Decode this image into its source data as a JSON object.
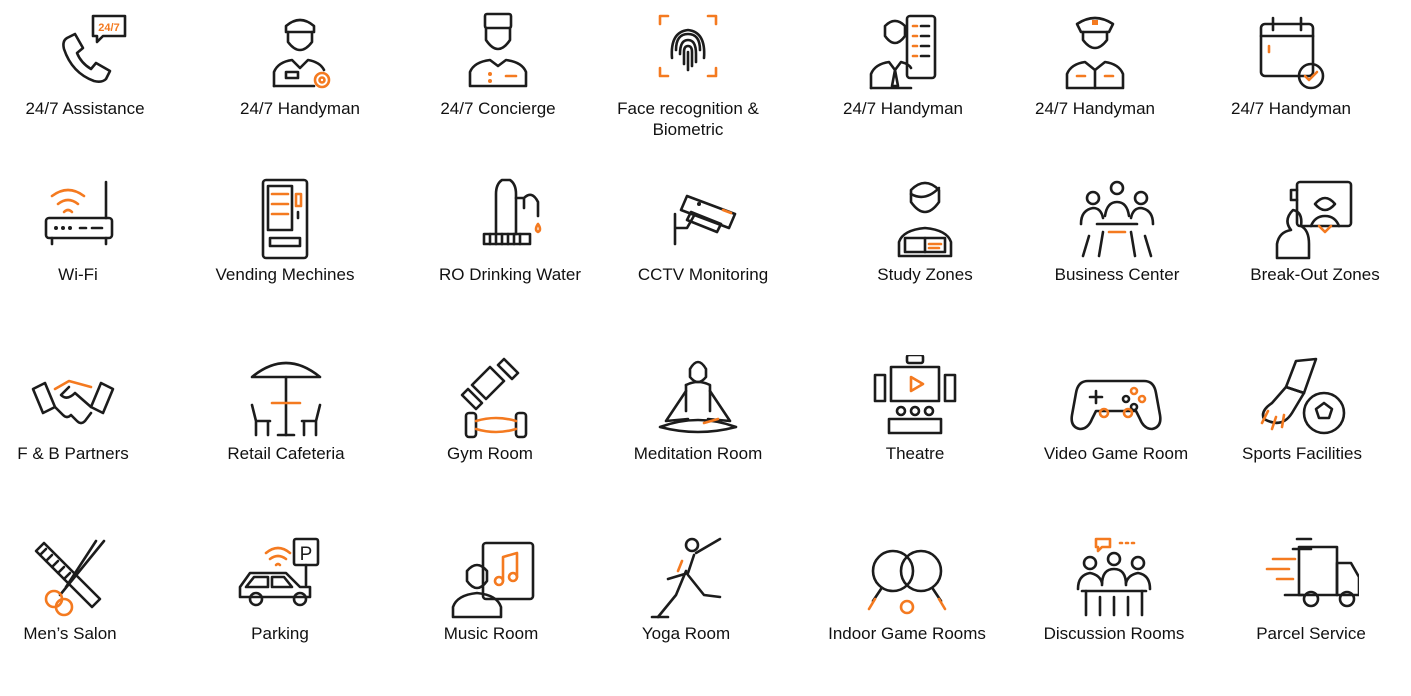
{
  "accent_color": "#f47a20",
  "line_color": "#1c1c1c",
  "amenities": [
    {
      "label": "24/7 Assistance",
      "icon": "phone-24-7-icon"
    },
    {
      "label": "24/7 Handyman",
      "icon": "handyman-gear-icon"
    },
    {
      "label": "24/7 Concierge",
      "icon": "concierge-icon"
    },
    {
      "label": "Face recognition & Biometric",
      "icon": "fingerprint-scan-icon"
    },
    {
      "label": "24/7 Handyman",
      "icon": "manager-checklist-icon"
    },
    {
      "label": "24/7 Handyman",
      "icon": "security-guard-icon"
    },
    {
      "label": "24/7 Handyman",
      "icon": "calendar-check-icon"
    },
    {
      "label": "Wi-Fi",
      "icon": "wifi-router-icon"
    },
    {
      "label": "Vending Mechines",
      "icon": "vending-machine-icon"
    },
    {
      "label": "RO Drinking Water",
      "icon": "water-purifier-icon"
    },
    {
      "label": "CCTV Monitoring",
      "icon": "cctv-camera-icon"
    },
    {
      "label": "Study Zones",
      "icon": "student-reading-icon"
    },
    {
      "label": "Business Center",
      "icon": "meeting-table-icon"
    },
    {
      "label": "Break-Out Zones",
      "icon": "video-call-icon"
    },
    {
      "label": "F & B Partners",
      "icon": "handshake-icon"
    },
    {
      "label": "Retail Cafeteria",
      "icon": "cafe-table-umbrella-icon"
    },
    {
      "label": "Gym Room",
      "icon": "dumbbell-icon"
    },
    {
      "label": "Meditation Room",
      "icon": "meditation-icon"
    },
    {
      "label": "Theatre",
      "icon": "theatre-screen-icon"
    },
    {
      "label": "Video Game Room",
      "icon": "gamepad-icon"
    },
    {
      "label": "Sports Facilities",
      "icon": "football-shoe-icon"
    },
    {
      "label": "Men’s Salon",
      "icon": "comb-scissors-icon"
    },
    {
      "label": "Parking",
      "icon": "car-parking-icon"
    },
    {
      "label": "Music Room",
      "icon": "music-lesson-icon"
    },
    {
      "label": "Yoga Room",
      "icon": "yoga-pose-icon"
    },
    {
      "label": "Indoor Game Rooms",
      "icon": "table-tennis-icon"
    },
    {
      "label": "Discussion Rooms",
      "icon": "discussion-group-icon"
    },
    {
      "label": "Parcel Service",
      "icon": "delivery-truck-icon"
    }
  ]
}
